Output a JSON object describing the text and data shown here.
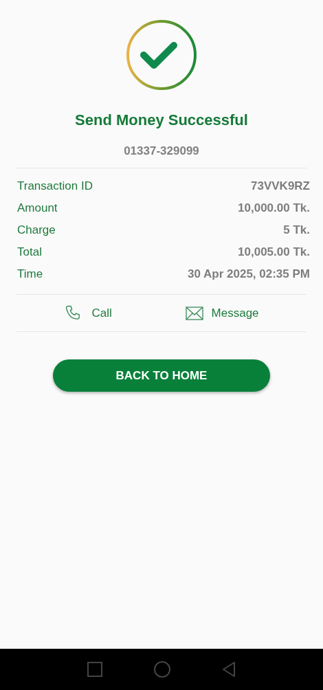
{
  "title": "Send Money Successful",
  "recipient": "01337-329099",
  "details": [
    {
      "label": "Transaction ID",
      "value": "73VVK9RZ"
    },
    {
      "label": "Amount",
      "value": "10,000.00 Tk."
    },
    {
      "label": "Charge",
      "value": "5 Tk."
    },
    {
      "label": "Total",
      "value": "10,005.00 Tk."
    },
    {
      "label": "Time",
      "value": "30 Apr 2025, 02:35 PM"
    }
  ],
  "actions": [
    {
      "kind": "call",
      "label": "Call"
    },
    {
      "kind": "message",
      "label": "Message"
    }
  ],
  "primary_button": "BACK TO HOME"
}
